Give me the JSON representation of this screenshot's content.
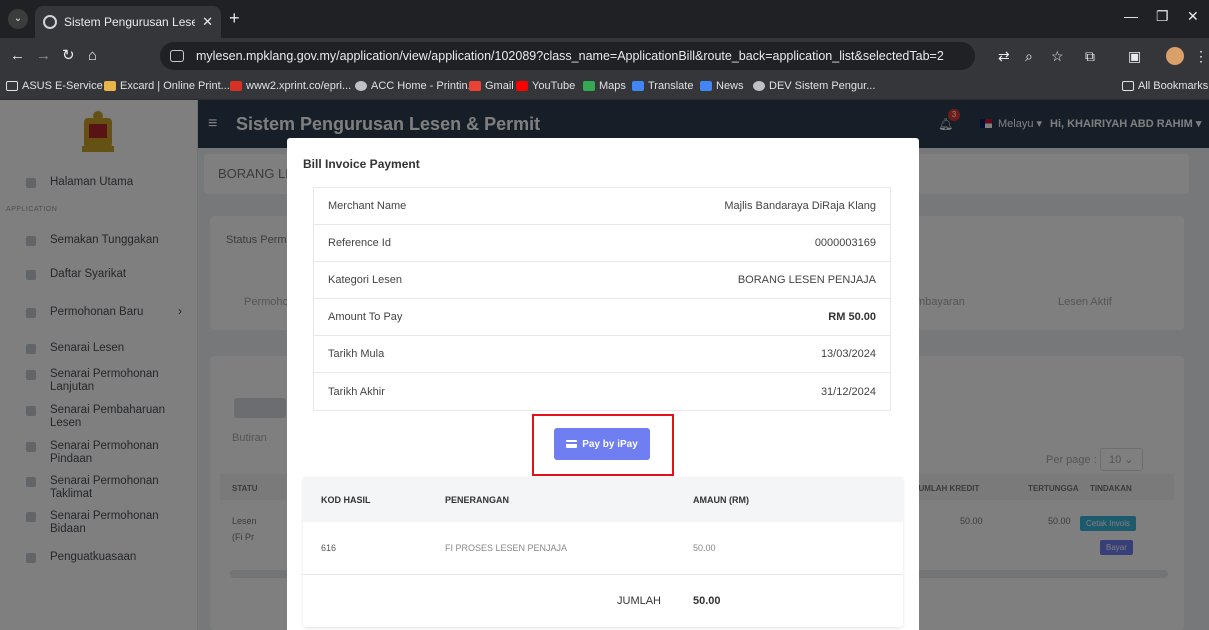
{
  "browser": {
    "tab_title": "Sistem Pengurusan Lesen & Pe",
    "tab_menu": "⌄",
    "tab_close": "✕",
    "new_tab": "+",
    "url": "mylesen.mpklang.gov.my/application/view/application/102089?class_name=ApplicationBill&route_back=application_list&selectedTab=2",
    "bookmarks": [
      {
        "label": "ASUS E-Service",
        "color": "#8ab4f8"
      },
      {
        "label": "Excard | Online Print...",
        "color": "#e9b44c"
      },
      {
        "label": "www2.xprint.co/epri...",
        "color": "#d93025"
      },
      {
        "label": "ACC Home - Printin...",
        "color": "#bdc1c6"
      },
      {
        "label": "Gmail",
        "color": "#ea4335"
      },
      {
        "label": "YouTube",
        "color": "#ff0000"
      },
      {
        "label": "Maps",
        "color": "#34a853"
      },
      {
        "label": "Translate",
        "color": "#4285f4"
      },
      {
        "label": "News",
        "color": "#4285f4"
      },
      {
        "label": "DEV Sistem Pengur...",
        "color": "#bdc1c6"
      }
    ],
    "all_bookmarks": "All Bookmarks"
  },
  "sidebar": {
    "caption": "APPLICATION",
    "items": [
      {
        "label": "Halaman Utama"
      },
      {
        "label": "Semakan Tunggakan"
      },
      {
        "label": "Daftar Syarikat"
      },
      {
        "label": "Permohonan Baru"
      },
      {
        "label": "Senarai Lesen"
      },
      {
        "label": "Senarai Permohonan Lanjutan"
      },
      {
        "label": "Senarai Pembaharuan Lesen"
      },
      {
        "label": "Senarai Permohonan Pindaan"
      },
      {
        "label": "Senarai Permohonan Taklimat"
      },
      {
        "label": "Senarai Permohonan Bidaan"
      },
      {
        "label": "Penguatkuasaan"
      }
    ],
    "chevron": "›"
  },
  "header": {
    "title": "Sistem Pengurusan Lesen & Permit",
    "notif_count": "3",
    "language": "Melayu ▾",
    "user": "Hi, KHAIRIYAH ABD RAHIM ▾"
  },
  "background": {
    "form_title": "BORANG LI",
    "status_label": "Status Permi",
    "step1": "Permohc",
    "step_pay": "mbayaran",
    "step_active": "Lesen Aktif",
    "tab_butiran": "Butiran",
    "per_page_label": "Per page :",
    "per_page_value": "10 ⌄",
    "col_status": "STATU",
    "col_jumlah_kredit": "JUMLAH KREDIT",
    "col_tertunggak": "TERTUNGGA",
    "col_tindakan": "TINDAKAN",
    "row_status": "Lesen",
    "row_status2": "(Fi Pr",
    "row_kredit": "50.00",
    "row_tertunggak": "50.00",
    "btn_cetak": "Cetak Invois",
    "btn_bayar": "Bayar"
  },
  "modal": {
    "title": "Bill Invoice Payment",
    "rows": [
      {
        "label": "Merchant Name",
        "value": "Majlis Bandaraya DiRaja Klang"
      },
      {
        "label": "Reference Id",
        "value": "0000003169"
      },
      {
        "label": "Kategori Lesen",
        "value": "BORANG LESEN PENJAJA"
      },
      {
        "label": "Amount To Pay",
        "value": "RM 50.00"
      },
      {
        "label": "Tarikh Mula",
        "value": "13/03/2024"
      },
      {
        "label": "Tarikh Akhir",
        "value": "31/12/2024"
      }
    ],
    "pay_button": "Pay by iPay",
    "bill": {
      "headers": [
        "KOD HASIL",
        "PENERANGAN",
        "AMAUN (RM)"
      ],
      "row": {
        "kod": "616",
        "penerangan": "FI PROSES LESEN PENJAJA",
        "amaun": "50.00"
      },
      "total_label": "JUMLAH",
      "total_value": "50.00"
    }
  },
  "colors": {
    "accent_button": "#6f7ff2",
    "highlight_border": "#e3111b",
    "header_bg": "#2c3e50"
  }
}
